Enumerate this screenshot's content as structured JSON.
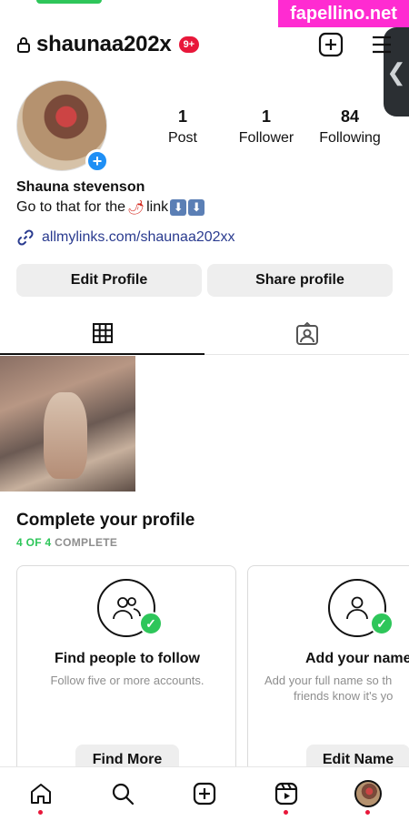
{
  "watermark": "fapellino.net",
  "header": {
    "username": "shaunaa202x",
    "notification_badge": "9+"
  },
  "profile": {
    "stats": [
      {
        "value": "1",
        "label": "Post"
      },
      {
        "value": "1",
        "label": "Follower"
      },
      {
        "value": "84",
        "label": "Following"
      }
    ],
    "display_name": "Shauna stevenson",
    "bio_text": "Go to that for the",
    "bio_link_word": "link",
    "bio_arrow_1": "⬇",
    "bio_arrow_2": "⬇",
    "link_url": "allmylinks.com/shaunaa202xx"
  },
  "actions": {
    "edit_profile": "Edit Profile",
    "share_profile": "Share profile"
  },
  "complete_profile": {
    "title": "Complete your profile",
    "progress_done": "4 OF 4",
    "progress_label": "COMPLETE",
    "cards": [
      {
        "title": "Find people to follow",
        "desc": "Follow five or more accounts.",
        "button": "Find More"
      },
      {
        "title": "Add your name",
        "desc_line1": "Add your full name so th",
        "desc_line2": "friends know it's yo",
        "button": "Edit Name"
      }
    ]
  },
  "colors": {
    "accent_green": "#2ec65a",
    "badge_red": "#e8173a",
    "plus_blue": "#1f8ff5",
    "watermark_pink": "#ff2bd1",
    "link_blue": "#2a3b8f"
  }
}
